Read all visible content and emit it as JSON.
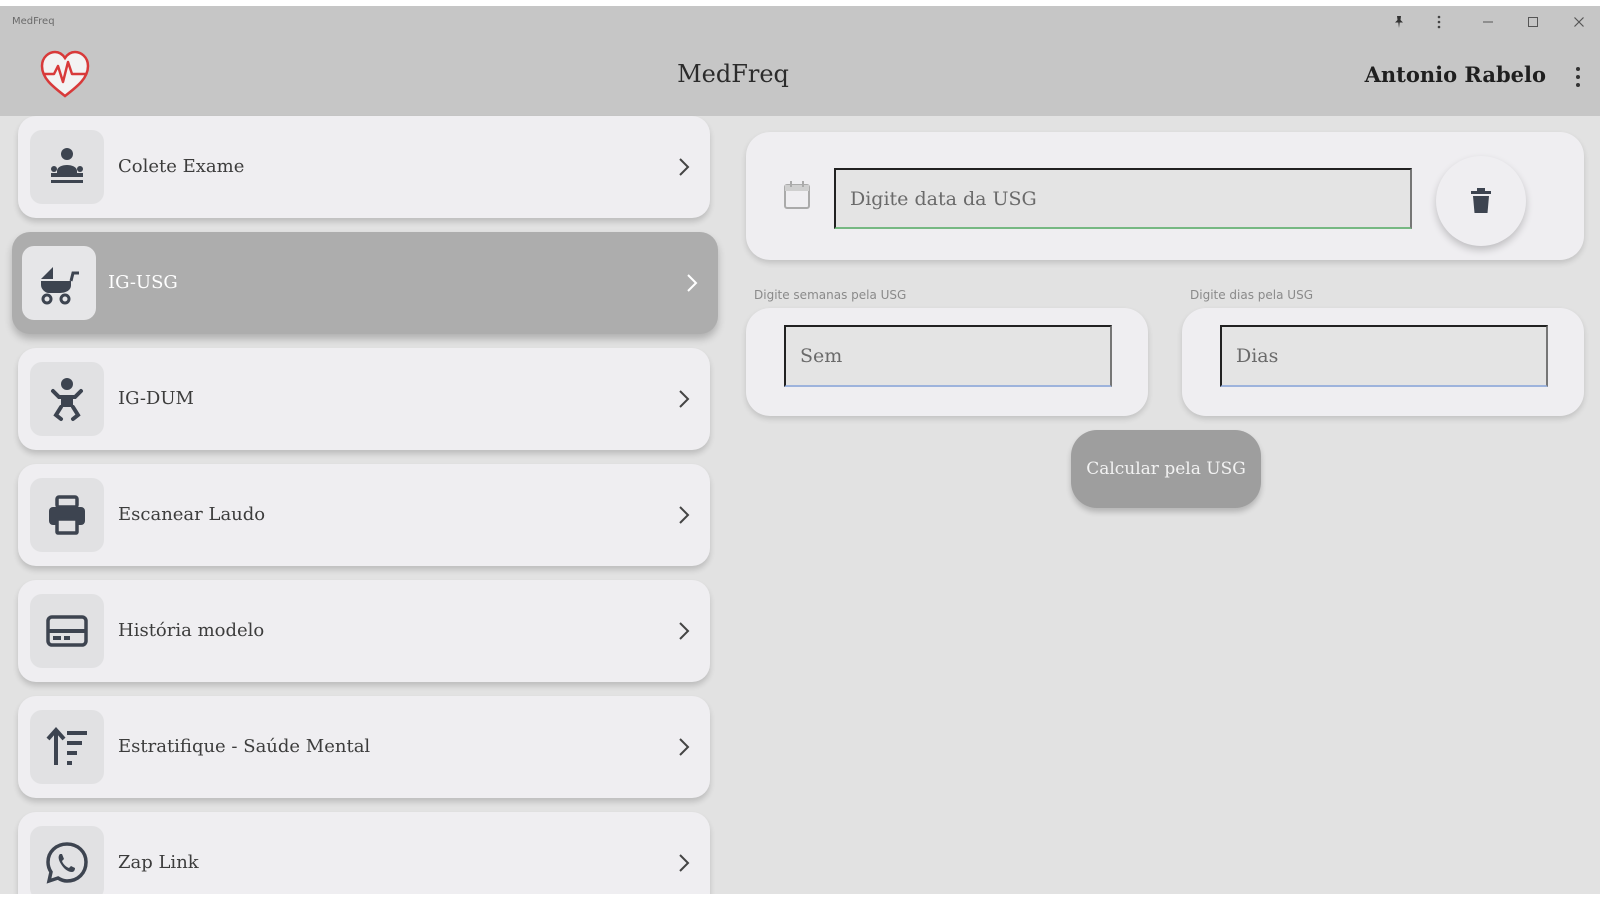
{
  "window": {
    "title": "MedFreq"
  },
  "header": {
    "title": "MedFreq",
    "user_name": "Antonio Rabelo",
    "logo_icon": "heart-pulse-icon"
  },
  "menu": {
    "items": [
      {
        "label": "Colete Exame",
        "icon": "patient-exam-icon",
        "active": false
      },
      {
        "label": "IG-USG",
        "icon": "baby-stroller-icon",
        "active": true
      },
      {
        "label": "IG-DUM",
        "icon": "baby-icon",
        "active": false
      },
      {
        "label": "Escanear Laudo",
        "icon": "printer-icon",
        "active": false
      },
      {
        "label": "História modelo",
        "icon": "template-card-icon",
        "active": false
      },
      {
        "label": "Estratifique - Saúde Mental",
        "icon": "sort-ascending-icon",
        "active": false
      },
      {
        "label": "Zap Link",
        "icon": "whatsapp-icon",
        "active": false
      }
    ]
  },
  "usg": {
    "date_placeholder": "Digite data da USG",
    "weeks_caption": "Digite semanas pela USG",
    "weeks_placeholder": "Sem",
    "days_caption": "Digite dias pela USG",
    "days_placeholder": "Dias",
    "calculate_label": "Calcular pela USG"
  },
  "colors": {
    "header_bg": "#c6c6c6",
    "page_bg": "#e2e2e2",
    "card_bg": "#efeef1",
    "active_item_bg": "#adadad",
    "date_underline": "#76b882",
    "number_underline": "#9db3dc",
    "button_bg": "#9e9e9e",
    "logo_red": "#d83a3a"
  }
}
